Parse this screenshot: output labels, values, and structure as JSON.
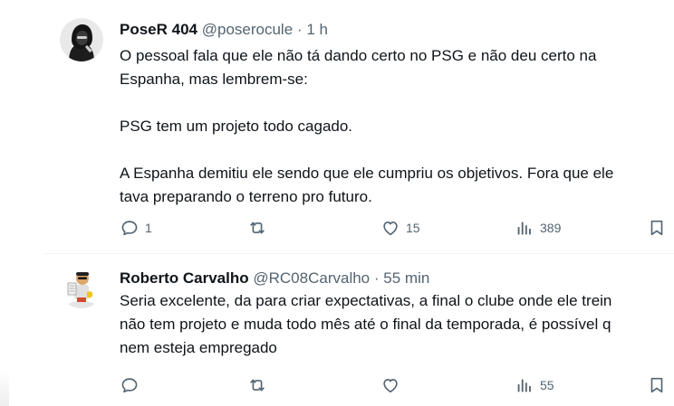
{
  "tweets": [
    {
      "author": {
        "name": "PoseR 404",
        "handle": "@poserocule",
        "avatar_icon": "hooded-figure-avatar-icon"
      },
      "separator": "·",
      "time": "1 h",
      "text": "O pessoal fala que ele não tá dando certo no PSG e não deu certo na\nEspanha, mas lembrem-se:\n\nPSG tem um projeto todo cagado.\n\nA Espanha demitiu ele sendo que ele cumpriu os objetivos. Fora que ele\ntava preparando o terreno pro futuro.",
      "stats": {
        "replies": "1",
        "retweets": "",
        "likes": "15",
        "views": "389"
      }
    },
    {
      "author": {
        "name": "Roberto Carvalho",
        "handle": "@RC08Carvalho",
        "avatar_icon": "cartoon-character-avatar-icon"
      },
      "separator": "·",
      "time": "55 min",
      "text": "Seria excelente, da para criar expectativas, a final o clube onde ele trein\nnão tem projeto e muda todo mês até o final da temporada, é possível q\nnem esteja empregado",
      "stats": {
        "replies": "",
        "retweets": "",
        "likes": "",
        "views": "55"
      }
    }
  ],
  "icons": {
    "reply": "reply-bubble-icon",
    "retweet": "retweet-arrows-icon",
    "like": "heart-icon",
    "views": "bar-chart-icon",
    "bookmark": "bookmark-icon"
  },
  "colors": {
    "text": "#0f1419",
    "secondary": "#536471",
    "divider": "#eff3f4"
  }
}
